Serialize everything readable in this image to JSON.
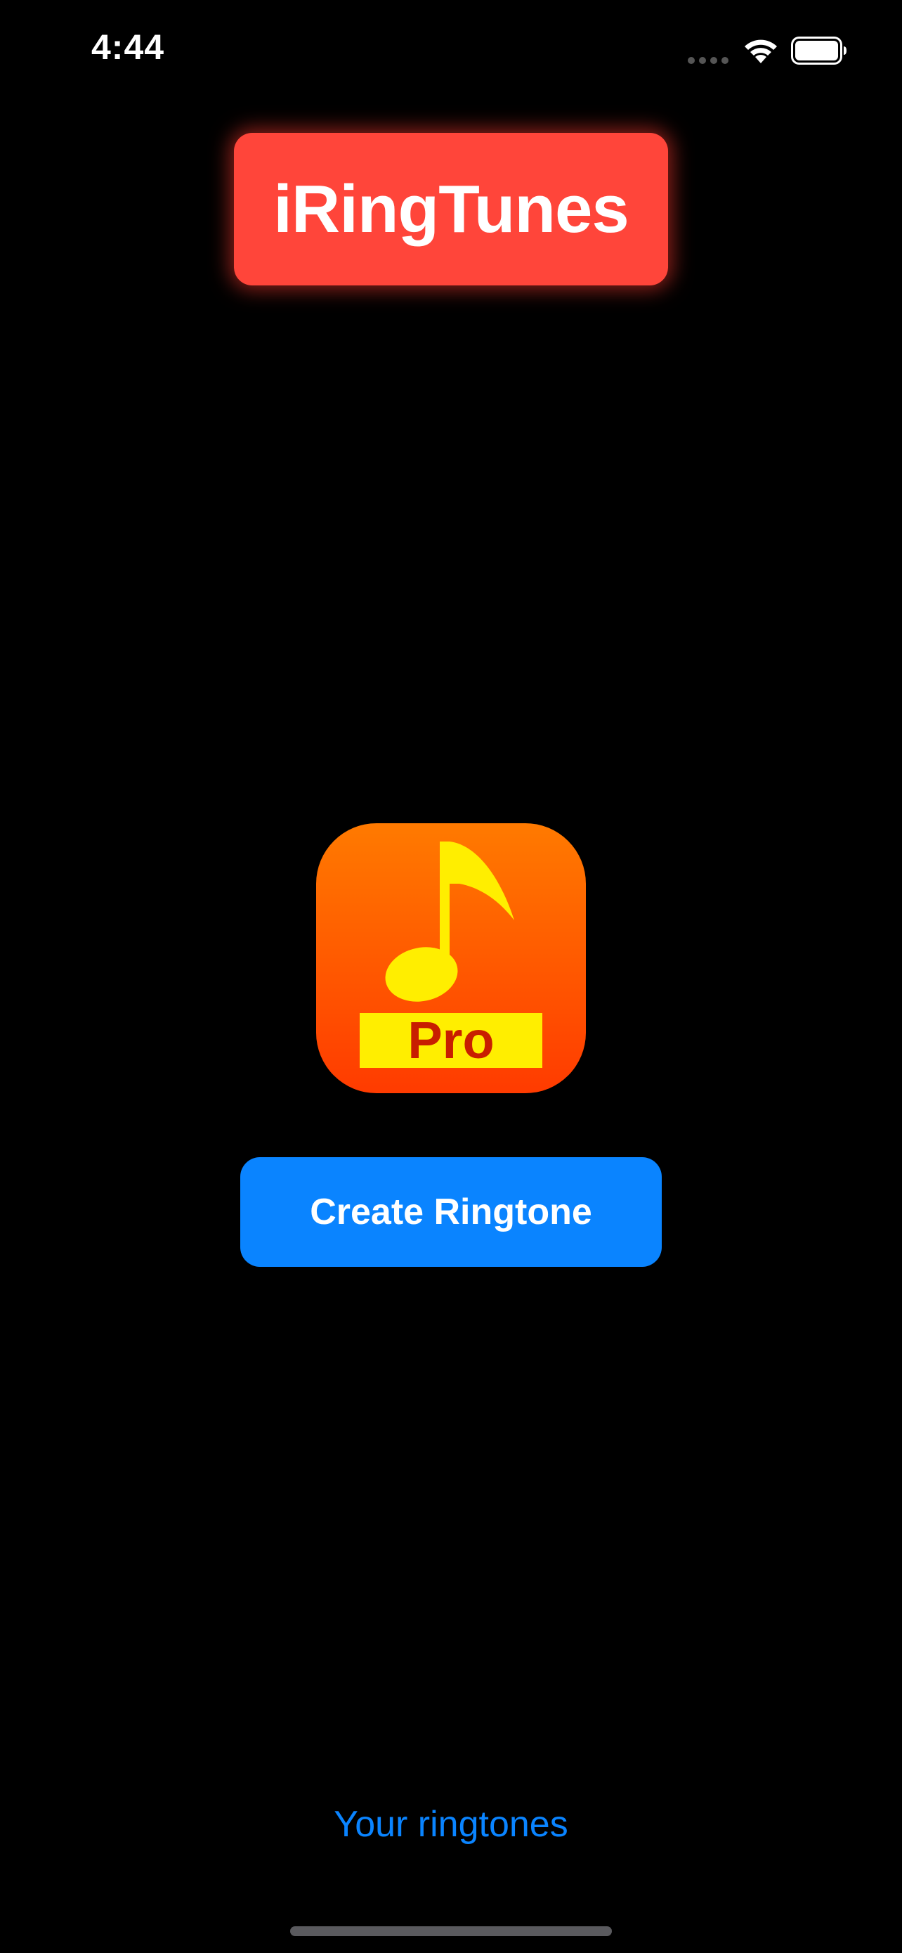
{
  "status_bar": {
    "time": "4:44",
    "icons": [
      "signal-dots-icon",
      "wifi-icon",
      "battery-icon"
    ]
  },
  "header": {
    "title": "iRingTunes",
    "badge_color": "#ff453a"
  },
  "app_icon": {
    "name": "music-note-pro-icon",
    "label": "Pro",
    "gradient_top": "#ff7a00",
    "gradient_bottom": "#ff3b00",
    "note_color": "#ffee00",
    "label_color": "#c81e00"
  },
  "actions": {
    "create_label": "Create Ringtone",
    "create_color": "#0a84ff",
    "ringtones_link": "Your ringtones"
  }
}
